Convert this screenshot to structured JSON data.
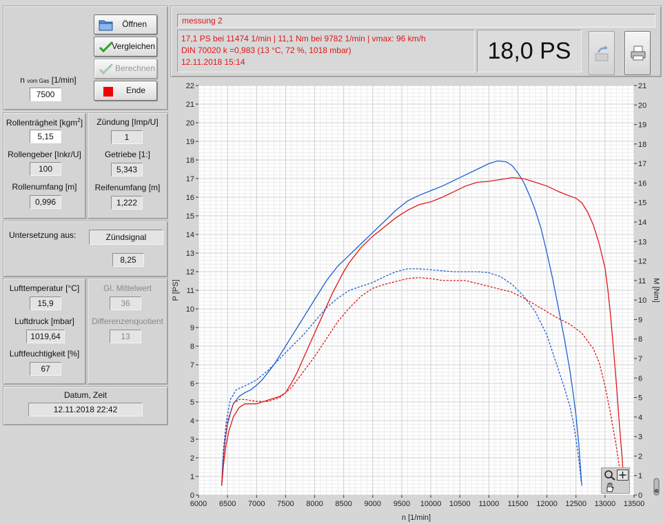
{
  "controls": {
    "n_label_main": "n",
    "n_label_sub": "vom Gas",
    "n_label_unit": "[1/min]",
    "n_value": "7500",
    "buttons": {
      "open": "Öffnen",
      "compare": "Vergleichen",
      "calculate": "Berechnen",
      "end": "Ende"
    }
  },
  "roller": {
    "inertia_label": "Rollenträgheit [kgm",
    "inertia_sup": "2",
    "inertia_close": "]",
    "inertia_value": "5,15",
    "encoder_label": "Rollengeber [Inkr/U]",
    "encoder_value": "100",
    "circumference_label": "Rollenumfang [m]",
    "circumference_value": "0,996",
    "ignition_label": "Zündung [Imp/U]",
    "ignition_value": "1",
    "gear_label": "Getriebe [1:]",
    "gear_value": "5,343",
    "tire_label": "Reifenumfang [m]",
    "tire_value": "1,222"
  },
  "reduction": {
    "label": "Untersetzung aus:",
    "source": "Zündsignal",
    "value": "8,25"
  },
  "air": {
    "temp_label": "Lufttemperatur [°C]",
    "temp_value": "15,9",
    "pressure_label": "Luftdruck [mbar]",
    "pressure_value": "1019,64",
    "humidity_label": "Luftfeuchtigkeit [%]",
    "humidity_value": "67",
    "avg_label": "Gl. Mittelwert",
    "avg_value": "36",
    "diff_label": "Differenzenquotient",
    "diff_value": "13"
  },
  "datetime": {
    "label": "Datum, Zeit",
    "value": "12.11.2018 22:42"
  },
  "measurement": {
    "name": "messung 2",
    "line1": "17,1 PS bei 11474 1/min   |   11,1 Nm bei 9782 1/min   |   vmax: 96 km/h",
    "line2": "DIN 70020 k =0,983 (13 °C, 72 %, 1018 mbar)",
    "line3": "12.11.2018 15:14",
    "power_display": "18,0 PS"
  },
  "colors": {
    "blue": "#1a5fd0",
    "red": "#e01515",
    "text_red": "#e01515"
  },
  "icons": {
    "open": "folder-icon",
    "compare": "checkmark-icon",
    "calculate": "checkmark-icon",
    "end": "red-square-icon",
    "export": "export-icon",
    "print": "printer-icon",
    "zoom": "zoom-icon",
    "pan": "hand-icon",
    "cursor": "crosshair-icon"
  },
  "chart_data": {
    "type": "line",
    "xlabel": "n [1/min]",
    "ylabel": "P [PS]",
    "y2label": "M [Nm]",
    "xlim": [
      6000,
      13500
    ],
    "ylim": [
      0,
      22
    ],
    "y2lim": [
      0,
      21
    ],
    "xticks": [
      6000,
      6500,
      7000,
      7500,
      8000,
      8500,
      9000,
      9500,
      10000,
      10500,
      11000,
      11500,
      12000,
      12500,
      13000,
      13500
    ],
    "yticks": [
      0,
      1,
      2,
      3,
      4,
      5,
      6,
      7,
      8,
      9,
      10,
      11,
      12,
      13,
      14,
      15,
      16,
      17,
      18,
      19,
      20,
      21,
      22
    ],
    "y2ticks": [
      0,
      1,
      2,
      3,
      4,
      5,
      6,
      7,
      8,
      9,
      10,
      11,
      12,
      13,
      14,
      15,
      16,
      17,
      18,
      19,
      20,
      21
    ],
    "grid": true,
    "series": [
      {
        "color": "blue",
        "style": "solid",
        "axis": "left",
        "points": [
          [
            6400,
            0.5
          ],
          [
            6420,
            1.8
          ],
          [
            6450,
            2.8
          ],
          [
            6500,
            3.8
          ],
          [
            6550,
            4.4
          ],
          [
            6600,
            4.9
          ],
          [
            6700,
            5.3
          ],
          [
            6800,
            5.5
          ],
          [
            6900,
            5.65
          ],
          [
            7000,
            5.9
          ],
          [
            7100,
            6.2
          ],
          [
            7200,
            6.6
          ],
          [
            7300,
            7.0
          ],
          [
            7400,
            7.5
          ],
          [
            7500,
            8.0
          ],
          [
            7600,
            8.5
          ],
          [
            7700,
            9.0
          ],
          [
            7800,
            9.5
          ],
          [
            7900,
            10.0
          ],
          [
            8000,
            10.5
          ],
          [
            8100,
            11.0
          ],
          [
            8200,
            11.5
          ],
          [
            8300,
            11.9
          ],
          [
            8400,
            12.3
          ],
          [
            8500,
            12.6
          ],
          [
            8600,
            12.9
          ],
          [
            8700,
            13.2
          ],
          [
            8800,
            13.5
          ],
          [
            8900,
            13.8
          ],
          [
            9000,
            14.1
          ],
          [
            9200,
            14.7
          ],
          [
            9400,
            15.3
          ],
          [
            9600,
            15.8
          ],
          [
            9800,
            16.1
          ],
          [
            10000,
            16.35
          ],
          [
            10200,
            16.6
          ],
          [
            10400,
            16.9
          ],
          [
            10600,
            17.2
          ],
          [
            10800,
            17.5
          ],
          [
            11000,
            17.8
          ],
          [
            11150,
            17.95
          ],
          [
            11300,
            17.9
          ],
          [
            11400,
            17.7
          ],
          [
            11500,
            17.3
          ],
          [
            11600,
            16.8
          ],
          [
            11700,
            16.1
          ],
          [
            11800,
            15.3
          ],
          [
            11900,
            14.3
          ],
          [
            12000,
            13.0
          ],
          [
            12100,
            11.6
          ],
          [
            12200,
            10.0
          ],
          [
            12300,
            8.4
          ],
          [
            12400,
            6.6
          ],
          [
            12450,
            5.5
          ],
          [
            12500,
            4.3
          ],
          [
            12550,
            2.7
          ],
          [
            12580,
            1.3
          ],
          [
            12600,
            0.5
          ]
        ]
      },
      {
        "color": "red",
        "style": "solid",
        "axis": "left",
        "points": [
          [
            6400,
            0.5
          ],
          [
            6430,
            1.6
          ],
          [
            6470,
            2.6
          ],
          [
            6520,
            3.4
          ],
          [
            6600,
            4.2
          ],
          [
            6700,
            4.7
          ],
          [
            6800,
            4.9
          ],
          [
            7000,
            4.9
          ],
          [
            7100,
            5.0
          ],
          [
            7200,
            5.1
          ],
          [
            7300,
            5.2
          ],
          [
            7400,
            5.3
          ],
          [
            7500,
            5.5
          ],
          [
            7600,
            6.0
          ],
          [
            7700,
            6.6
          ],
          [
            7800,
            7.3
          ],
          [
            7900,
            8.0
          ],
          [
            8000,
            8.7
          ],
          [
            8100,
            9.4
          ],
          [
            8200,
            10.1
          ],
          [
            8300,
            10.8
          ],
          [
            8400,
            11.4
          ],
          [
            8500,
            12.0
          ],
          [
            8600,
            12.5
          ],
          [
            8700,
            12.9
          ],
          [
            8800,
            13.3
          ],
          [
            9000,
            13.9
          ],
          [
            9200,
            14.4
          ],
          [
            9400,
            14.9
          ],
          [
            9600,
            15.3
          ],
          [
            9800,
            15.6
          ],
          [
            10000,
            15.75
          ],
          [
            10200,
            16.0
          ],
          [
            10400,
            16.3
          ],
          [
            10600,
            16.6
          ],
          [
            10800,
            16.8
          ],
          [
            11000,
            16.85
          ],
          [
            11200,
            16.95
          ],
          [
            11400,
            17.05
          ],
          [
            11600,
            17.0
          ],
          [
            11800,
            16.8
          ],
          [
            12000,
            16.6
          ],
          [
            12200,
            16.3
          ],
          [
            12400,
            16.05
          ],
          [
            12500,
            15.95
          ],
          [
            12600,
            15.7
          ],
          [
            12700,
            15.2
          ],
          [
            12800,
            14.5
          ],
          [
            12900,
            13.5
          ],
          [
            13000,
            12.2
          ],
          [
            13050,
            11.0
          ],
          [
            13100,
            9.5
          ],
          [
            13150,
            7.7
          ],
          [
            13200,
            5.8
          ],
          [
            13250,
            3.7
          ],
          [
            13300,
            1.8
          ],
          [
            13320,
            0.8
          ]
        ]
      },
      {
        "color": "blue",
        "style": "dashed",
        "axis": "right",
        "points": [
          [
            6400,
            0.5
          ],
          [
            6430,
            2.3
          ],
          [
            6480,
            3.8
          ],
          [
            6550,
            4.9
          ],
          [
            6650,
            5.4
          ],
          [
            6800,
            5.6
          ],
          [
            7000,
            5.9
          ],
          [
            7200,
            6.4
          ],
          [
            7400,
            7.0
          ],
          [
            7600,
            7.6
          ],
          [
            7800,
            8.2
          ],
          [
            8000,
            8.9
          ],
          [
            8200,
            9.6
          ],
          [
            8400,
            10.1
          ],
          [
            8600,
            10.5
          ],
          [
            8800,
            10.7
          ],
          [
            9000,
            10.9
          ],
          [
            9200,
            11.2
          ],
          [
            9400,
            11.45
          ],
          [
            9600,
            11.6
          ],
          [
            9800,
            11.6
          ],
          [
            10000,
            11.55
          ],
          [
            10200,
            11.5
          ],
          [
            10400,
            11.45
          ],
          [
            10600,
            11.45
          ],
          [
            10800,
            11.45
          ],
          [
            11000,
            11.4
          ],
          [
            11200,
            11.2
          ],
          [
            11400,
            10.8
          ],
          [
            11600,
            10.2
          ],
          [
            11800,
            9.4
          ],
          [
            12000,
            8.2
          ],
          [
            12100,
            7.3
          ],
          [
            12200,
            6.4
          ],
          [
            12300,
            5.5
          ],
          [
            12400,
            4.5
          ],
          [
            12450,
            3.8
          ],
          [
            12500,
            2.9
          ],
          [
            12550,
            1.8
          ],
          [
            12590,
            0.7
          ]
        ]
      },
      {
        "color": "red",
        "style": "dashed",
        "axis": "right",
        "points": [
          [
            6400,
            0.5
          ],
          [
            6440,
            2.3
          ],
          [
            6500,
            3.8
          ],
          [
            6600,
            4.7
          ],
          [
            6700,
            4.9
          ],
          [
            6800,
            4.9
          ],
          [
            7000,
            4.8
          ],
          [
            7200,
            4.8
          ],
          [
            7400,
            5.0
          ],
          [
            7600,
            5.5
          ],
          [
            7800,
            6.3
          ],
          [
            8000,
            7.1
          ],
          [
            8200,
            8.0
          ],
          [
            8400,
            8.9
          ],
          [
            8600,
            9.6
          ],
          [
            8800,
            10.2
          ],
          [
            9000,
            10.6
          ],
          [
            9200,
            10.8
          ],
          [
            9400,
            10.95
          ],
          [
            9600,
            11.1
          ],
          [
            9800,
            11.15
          ],
          [
            10000,
            11.1
          ],
          [
            10200,
            11.0
          ],
          [
            10400,
            11.0
          ],
          [
            10600,
            11.0
          ],
          [
            10800,
            10.85
          ],
          [
            11000,
            10.7
          ],
          [
            11200,
            10.55
          ],
          [
            11400,
            10.4
          ],
          [
            11600,
            10.1
          ],
          [
            11800,
            9.75
          ],
          [
            12000,
            9.4
          ],
          [
            12200,
            9.05
          ],
          [
            12400,
            8.75
          ],
          [
            12600,
            8.3
          ],
          [
            12800,
            7.5
          ],
          [
            12900,
            6.8
          ],
          [
            13000,
            5.6
          ],
          [
            13100,
            4.1
          ],
          [
            13200,
            2.4
          ],
          [
            13260,
            1.2
          ],
          [
            13300,
            0.4
          ]
        ]
      }
    ]
  }
}
